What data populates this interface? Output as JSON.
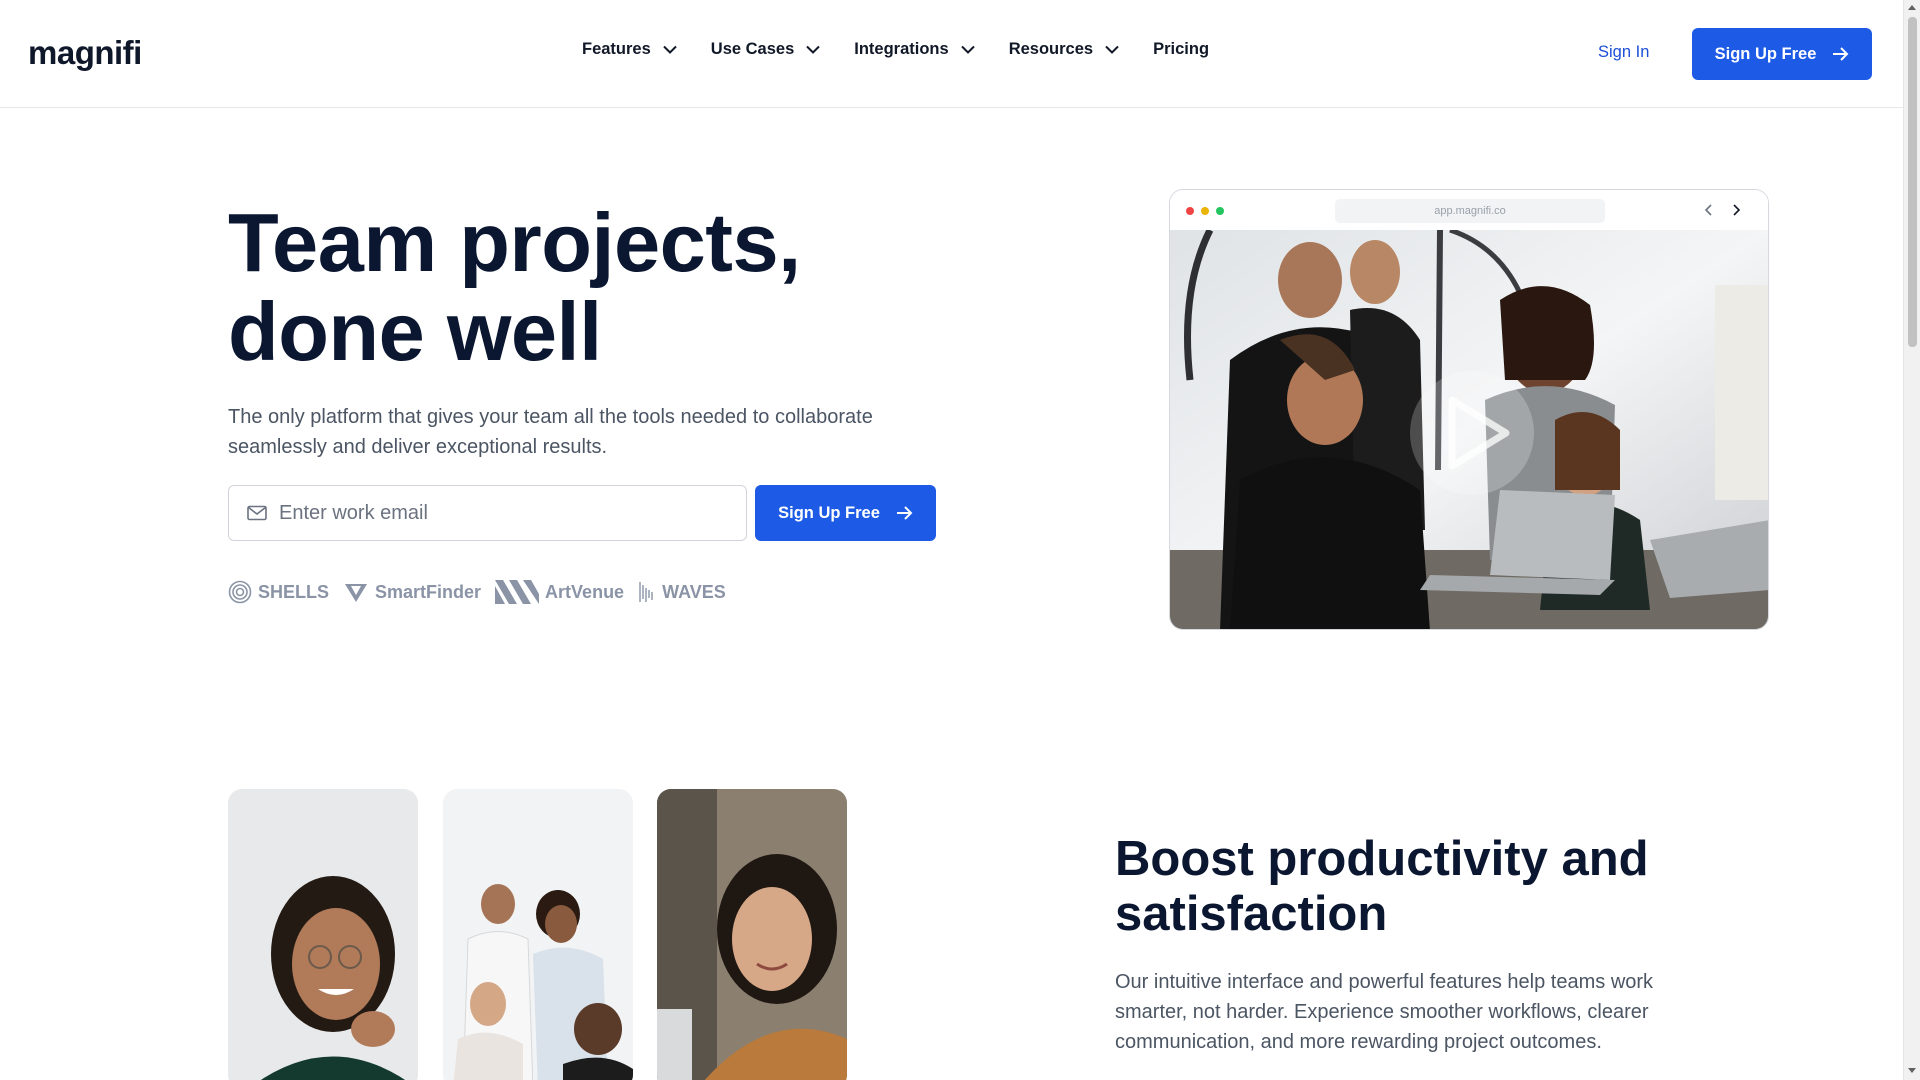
{
  "header": {
    "logo": "magnifi",
    "nav": [
      {
        "label": "Features",
        "has_dropdown": true
      },
      {
        "label": "Use Cases",
        "has_dropdown": true
      },
      {
        "label": "Integrations",
        "has_dropdown": true
      },
      {
        "label": "Resources",
        "has_dropdown": true
      },
      {
        "label": "Pricing",
        "has_dropdown": false
      }
    ],
    "sign_in": "Sign In",
    "sign_up": "Sign Up Free"
  },
  "hero": {
    "title_line1": "Team projects,",
    "title_line2": "done well",
    "subtitle": "The only platform that gives your team all the tools needed to collaborate seamlessly and deliver exceptional results.",
    "email_placeholder": "Enter work email",
    "email_icon": "mail-icon",
    "cta": "Sign Up Free",
    "brands": [
      "SHELLS",
      "SmartFinder",
      "ArtVenue",
      "WAVES"
    ]
  },
  "browser_mockup": {
    "url": "app.magnifi.co",
    "dot_colors": [
      "#ef4444",
      "#eab308",
      "#22c55e"
    ],
    "play_icon": "play-icon"
  },
  "section2": {
    "title": "Boost productivity and satisfaction",
    "text": "Our intuitive interface and powerful features help teams work smarter, not harder. Experience smoother workflows, clearer communication, and more rewarding project outcomes."
  },
  "colors": {
    "primary": "#1d5be6",
    "heading": "#0b1730",
    "body": "#4b5563",
    "brand_gray": "#8a94a6"
  }
}
